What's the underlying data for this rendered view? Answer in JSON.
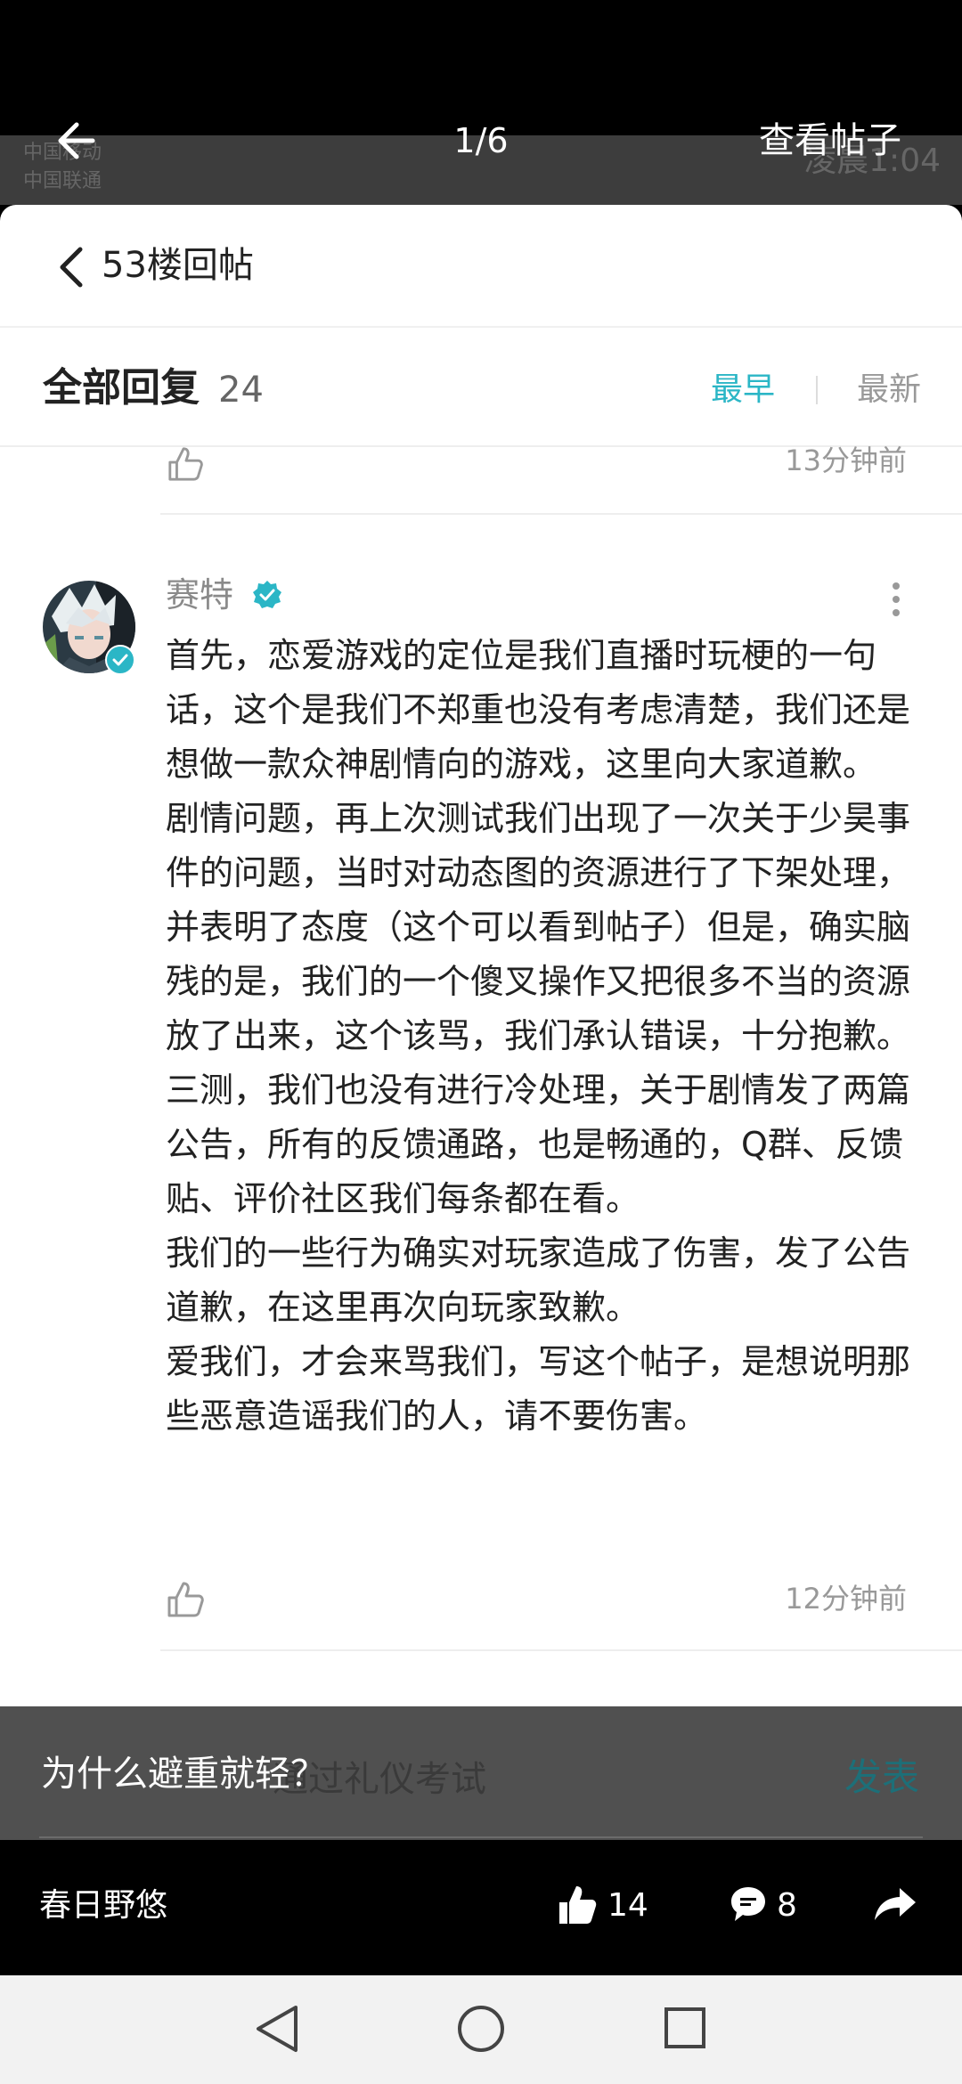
{
  "viewer": {
    "counter": "1/6",
    "action_label": "查看帖子",
    "ghost_carrier_1": "中国移动",
    "ghost_carrier_2": "中国联通",
    "ghost_clock": "凌晨1:04"
  },
  "card": {
    "title": "53楼回帖",
    "replies_title": "全部回复",
    "replies_count": "24",
    "sort_earliest": "最早",
    "sort_latest": "最新",
    "prev_reply_time": "13分钟前"
  },
  "reply": {
    "author": "赛特",
    "paragraphs": [
      "首先，恋爱游戏的定位是我们直播时玩梗的一句话，这个是我们不郑重也没有考虑清楚，我们还是想做一款众神剧情向的游戏，这里向大家道歉。",
      "剧情问题，再上次测试我们出现了一次关于少昊事件的问题，当时对动态图的资源进行了下架处理，并表明了态度（这个可以看到帖子）但是，确实脑残的是，我们的一个傻叉操作又把很多不当的资源放了出来，这个该骂，我们承认错误，十分抱歉。",
      "三测，我们也没有进行冷处理，关于剧情发了两篇公告，所有的反馈通路，也是畅通的，Q群、反馈贴、评价社区我们每条都在看。",
      "我们的一些行为确实对玩家造成了伤害，发了公告道歉，在这里再次向玩家致歉。",
      "爱我们，才会来骂我们，写这个帖子，是想说明那些恶意造谣我们的人，请不要伤害。"
    ],
    "time": "12分钟前"
  },
  "overlay": {
    "caption": "为什么避重就轻？",
    "ghost_input": "通过礼仪考试",
    "ghost_send": "发表"
  },
  "bottom_bar": {
    "poster": "春日野悠",
    "likes": "14",
    "comments": "8"
  },
  "colors": {
    "accent": "#2bb6c6",
    "verified": "#2bb6c6"
  }
}
